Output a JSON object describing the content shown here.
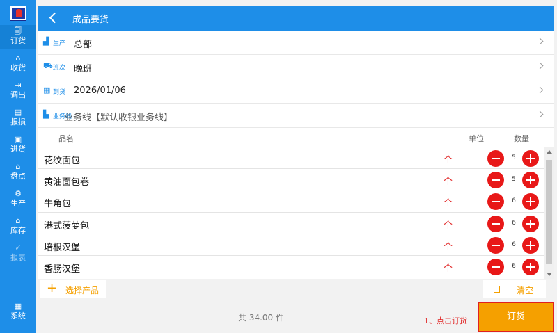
{
  "colors": {
    "primary": "#1e8ee8",
    "accent": "#f5a000",
    "danger": "#e81818"
  },
  "sidebar": {
    "items": [
      {
        "label": "订货",
        "icon": "order-icon"
      },
      {
        "label": "收货",
        "icon": "receive-icon"
      },
      {
        "label": "调出",
        "icon": "transfer-out-icon"
      },
      {
        "label": "报损",
        "icon": "damage-report-icon"
      },
      {
        "label": "进货",
        "icon": "purchase-icon"
      },
      {
        "label": "盘点",
        "icon": "inventory-check-icon"
      },
      {
        "label": "生产",
        "icon": "production-icon"
      },
      {
        "label": "库存",
        "icon": "stock-icon"
      },
      {
        "label": "报表",
        "icon": "report-icon"
      },
      {
        "label": "系统",
        "icon": "system-grid-icon"
      }
    ]
  },
  "header": {
    "title": "成品要货"
  },
  "info": {
    "production": {
      "tag": "生产",
      "value": "总部"
    },
    "shift": {
      "tag": "班次",
      "value": "晚班"
    },
    "arrival": {
      "tag": "到货",
      "value": "2026/01/06"
    },
    "business_line": {
      "tag": "业务线",
      "value": "业务线【默认收银业务线】"
    }
  },
  "table": {
    "headers": {
      "name": "品名",
      "unit": "单位",
      "qty": "数量"
    },
    "items": [
      {
        "name": "花纹面包",
        "unit": "个",
        "qty": "5"
      },
      {
        "name": "黄油面包卷",
        "unit": "个",
        "qty": "5"
      },
      {
        "name": "牛角包",
        "unit": "个",
        "qty": "6"
      },
      {
        "name": "港式菠萝包",
        "unit": "个",
        "qty": "6"
      },
      {
        "name": "培根汉堡",
        "unit": "个",
        "qty": "6"
      },
      {
        "name": "香肠汉堡",
        "unit": "个",
        "qty": "6"
      }
    ]
  },
  "actions": {
    "select_label": "选择产品",
    "clear_label": "清空"
  },
  "footer": {
    "total": "共 34.00 件",
    "hint": "1、点击订货",
    "order_label": "订货"
  }
}
